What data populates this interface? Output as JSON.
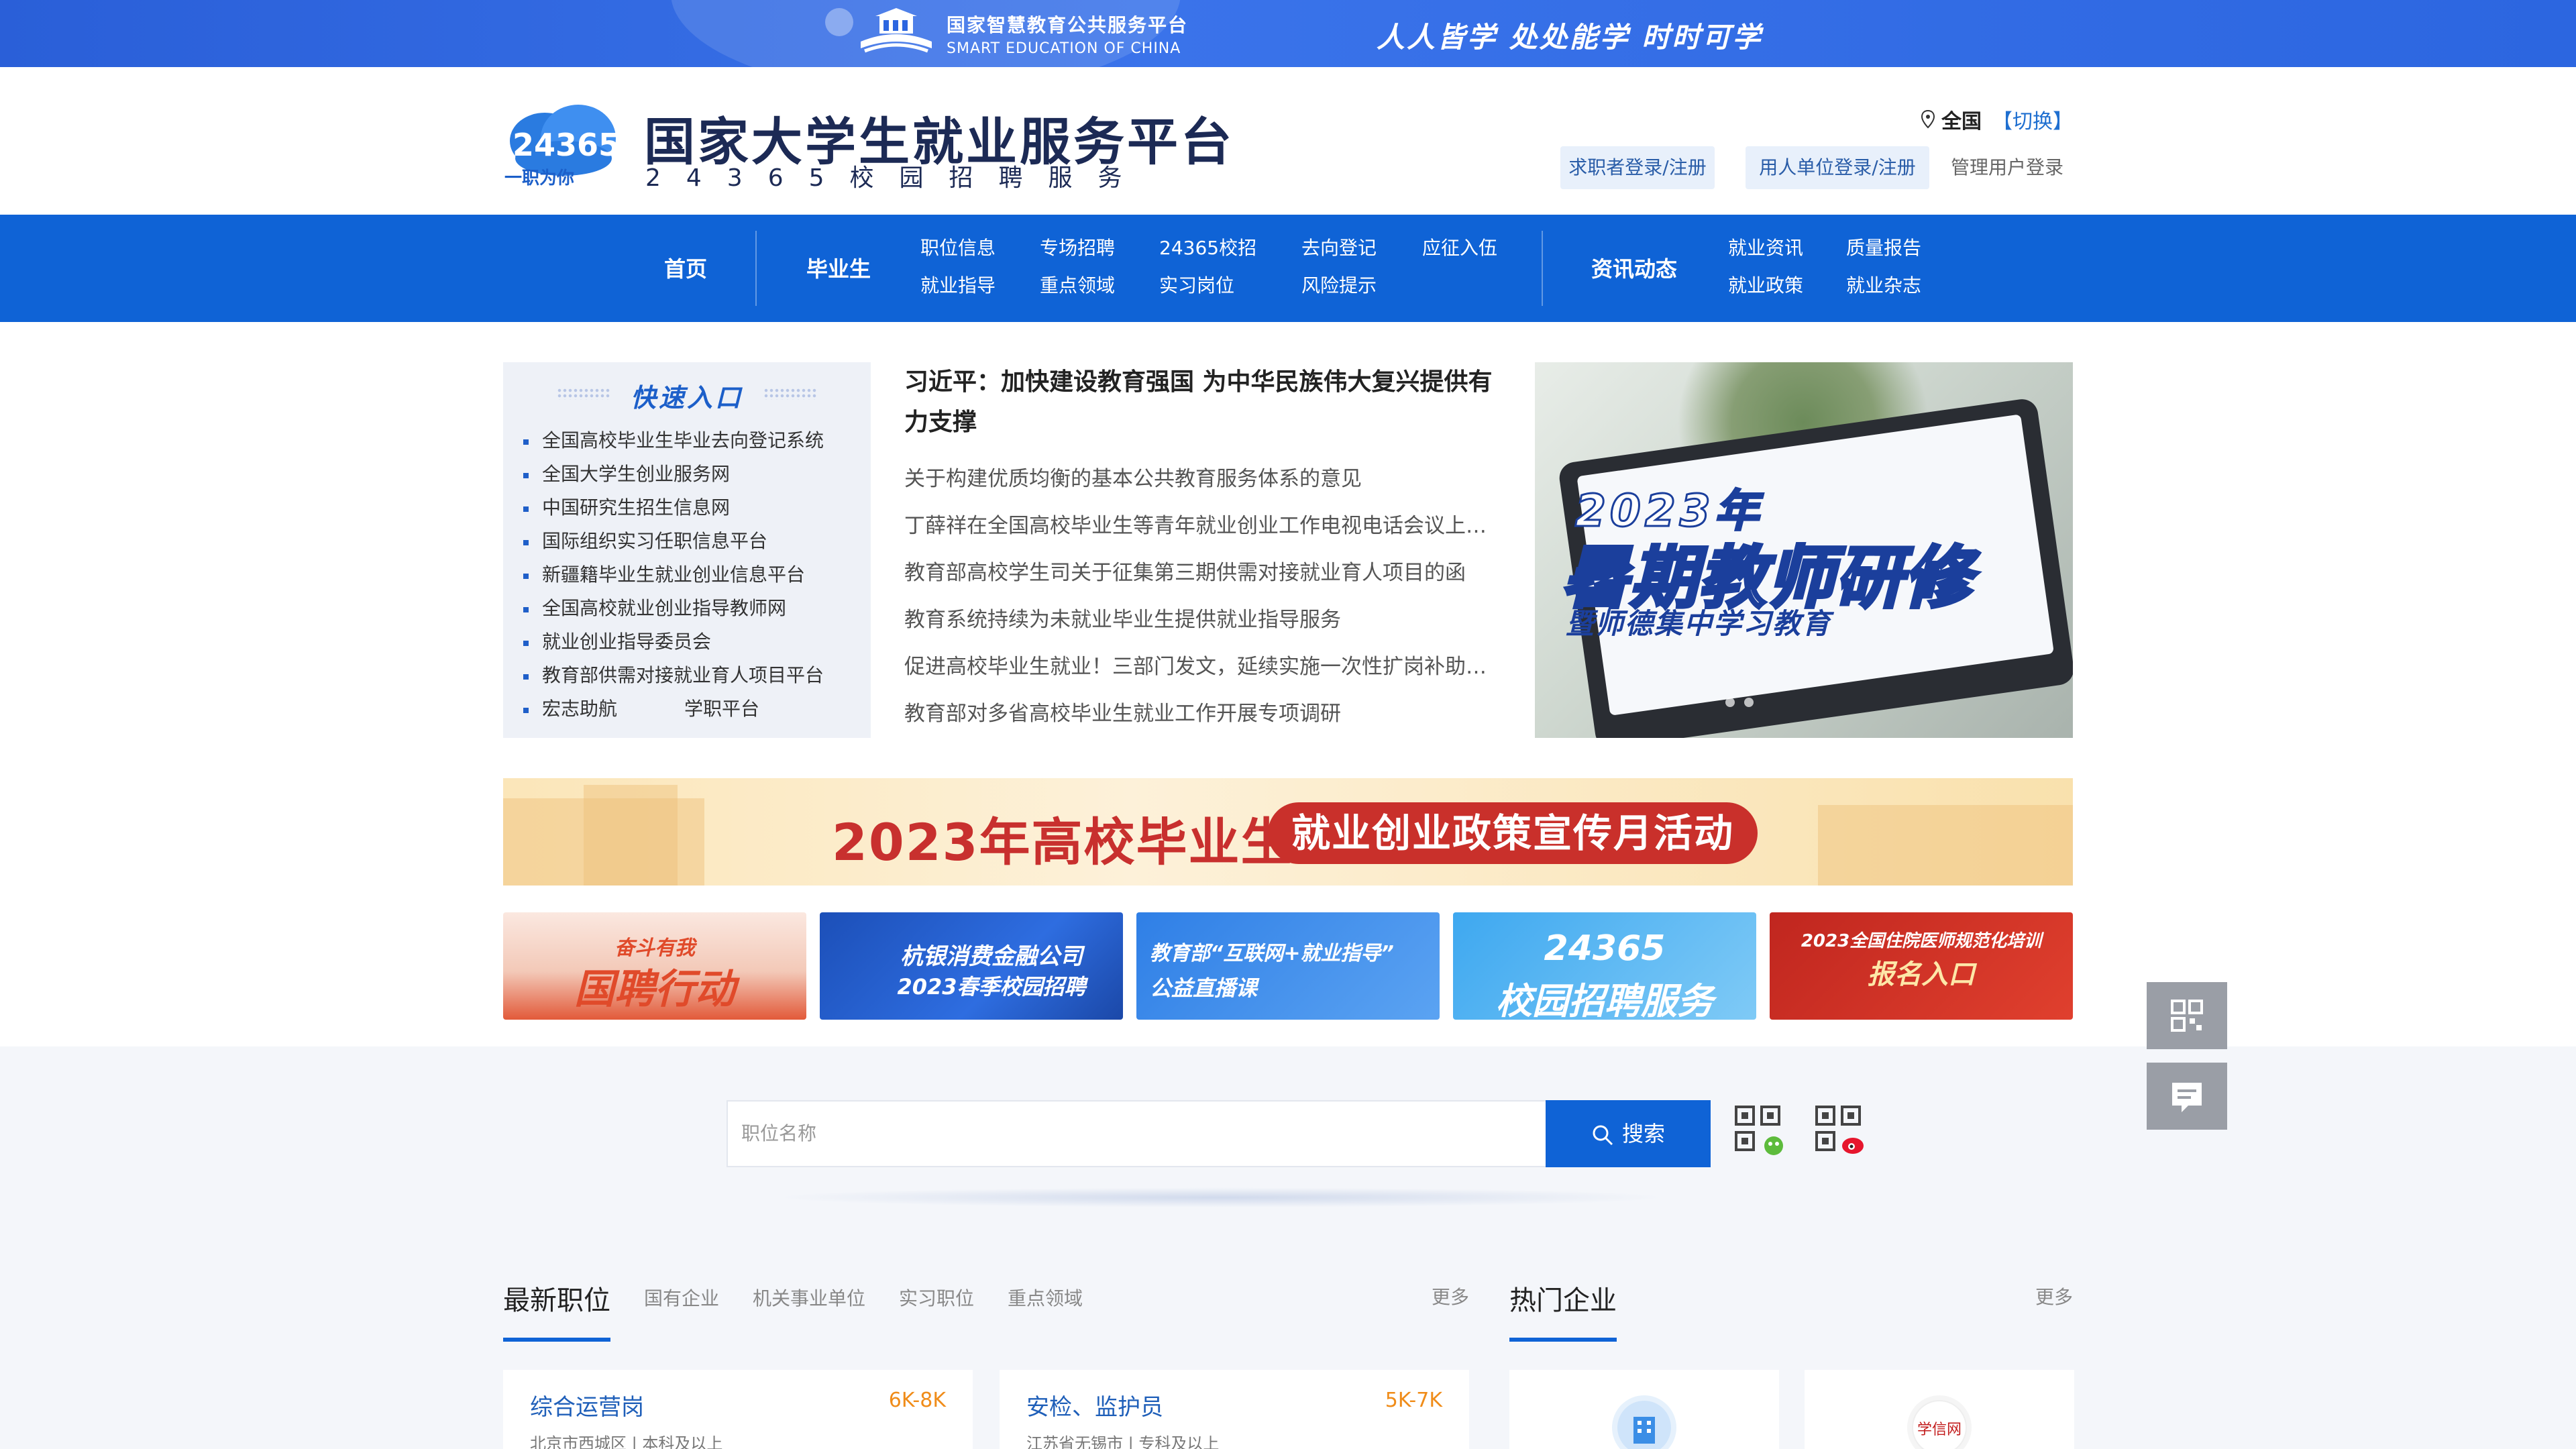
{
  "topbar": {
    "platform_cn": "国家智慧教育公共服务平台",
    "platform_en": "SMART EDUCATION OF CHINA",
    "slogan": "人人皆学 处处能学 时时可学"
  },
  "header": {
    "logo_badge": "24365",
    "logo_tag": "一职为你",
    "title": "国家大学生就业服务平台",
    "subtitle": "24365校园招聘服务",
    "region": "全国",
    "switch": "【切换】",
    "seeker_login": "求职者登录/注册",
    "employer_login": "用人单位登录/注册",
    "admin_login": "管理用户登录"
  },
  "nav": {
    "home": "首页",
    "graduates": "毕业生",
    "grad_links": [
      "职位信息",
      "专场招聘",
      "24365校招",
      "去向登记",
      "应征入伍",
      "就业指导",
      "重点领域",
      "实习岗位",
      "风险提示"
    ],
    "news": "资讯动态",
    "news_links": [
      "就业资讯",
      "质量报告",
      "就业政策",
      "就业杂志"
    ]
  },
  "quick": {
    "title": "快速入口",
    "items": [
      "全国高校毕业生毕业去向登记系统",
      "全国大学生创业服务网",
      "中国研究生招生信息网",
      "国际组织实习任职信息平台",
      "新疆籍毕业生就业创业信息平台",
      "全国高校就业创业指导教师网",
      "就业创业指导委员会",
      "教育部供需对接就业育人项目平台"
    ],
    "last_left": "宏志助航",
    "last_right": "学职平台"
  },
  "news": {
    "headline": "习近平：加快建设教育强国 为中华民族伟大复兴提供有力支撑",
    "items": [
      "关于构建优质均衡的基本公共教育服务体系的意见",
      "丁薛祥在全国高校毕业生等青年就业创业工作电视电话会议上强调",
      "教育部高校学生司关于征集第三期供需对接就业育人项目的函",
      "教育系统持续为未就业毕业生提供就业指导服务",
      "促进高校毕业生就业！三部门发文，延续实施一次性扩岗补助政策",
      "教育部对多省高校毕业生就业工作开展专项调研"
    ]
  },
  "hero": {
    "line1": "2023年",
    "line2": "暑期教师研修",
    "line3": "暨师德集中学习教育"
  },
  "wide_banner": {
    "title": "2023年高校毕业生",
    "pill": "就业创业政策宣传月活动"
  },
  "tiles": [
    {
      "text": "国聘行动",
      "top": "奋斗有我"
    },
    {
      "text": "杭银消费金融公司",
      "sub": "2023春季校园招聘"
    },
    {
      "text": "教育部“互联网+就业指导”",
      "sub": "公益直播课"
    },
    {
      "text": "24365",
      "sub": "校园招聘服务"
    },
    {
      "text": "2023全国住院医师规范化培训",
      "sub": "报名入口"
    }
  ],
  "search": {
    "placeholder": "职位名称",
    "button": "搜索"
  },
  "latest": {
    "title": "最新职位",
    "tabs": [
      "国有企业",
      "机关事业单位",
      "实习职位",
      "重点领域"
    ],
    "more": "更多",
    "jobs": [
      {
        "title": "综合运营岗",
        "salary": "6K-8K",
        "meta": "北京市西城区 | 本科及以上"
      },
      {
        "title": "安检、监护员",
        "salary": "5K-7K",
        "meta": "江苏省无锡市 | 专科及以上"
      }
    ]
  },
  "hot": {
    "title": "热门企业",
    "more": "更多",
    "company2": "学信网"
  },
  "colors": {
    "primary": "#0f63d6",
    "topbar": "#2c66e0",
    "salary": "#f08c19",
    "banner_red": "#c9302b"
  }
}
